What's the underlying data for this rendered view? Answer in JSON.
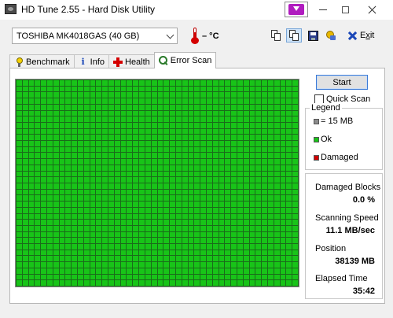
{
  "window": {
    "title": "HD Tune 2.55 - Hard Disk Utility",
    "icons": [
      "app-icon",
      "media-button-icon",
      "minimize-icon",
      "maximize-icon",
      "close-icon"
    ]
  },
  "toolbar": {
    "drive": "TOSHIBA MK4018GAS (40 GB)",
    "temperature": "– °C",
    "exit_label": "Exit",
    "exit_accel": "x",
    "exit_pre": "E",
    "exit_post": "it",
    "icons": [
      "thermometer-icon",
      "copy-icon",
      "copy-all-icon",
      "save-icon",
      "options-icon",
      "exit-icon"
    ]
  },
  "tabs": [
    {
      "label": "Benchmark",
      "icon": "lightbulb-icon",
      "active": false
    },
    {
      "label": "Info",
      "icon": "info-icon",
      "active": false
    },
    {
      "label": "Health",
      "icon": "health-cross-icon",
      "active": false
    },
    {
      "label": "Error Scan",
      "icon": "magnifier-icon",
      "active": true
    }
  ],
  "scan": {
    "start_label": "Start",
    "quick_scan_label": "Quick Scan",
    "quick_scan_checked": false,
    "grid": {
      "columns": 46,
      "rows": 34,
      "block_color": "#18c418",
      "status": "all-ok"
    }
  },
  "legend": {
    "title": "Legend",
    "items": [
      {
        "label": "= 15 MB",
        "color": "#8c8c8c"
      },
      {
        "label": "Ok",
        "color": "#18c418"
      },
      {
        "label": "Damaged",
        "color": "#d00000"
      }
    ]
  },
  "stats": {
    "damaged_blocks_label": "Damaged Blocks",
    "damaged_blocks_value": "0.0 %",
    "scanning_speed_label": "Scanning Speed",
    "scanning_speed_value": "11.1 MB/sec",
    "position_label": "Position",
    "position_value": "38139 MB",
    "elapsed_time_label": "Elapsed Time",
    "elapsed_time_value": "35:42"
  }
}
